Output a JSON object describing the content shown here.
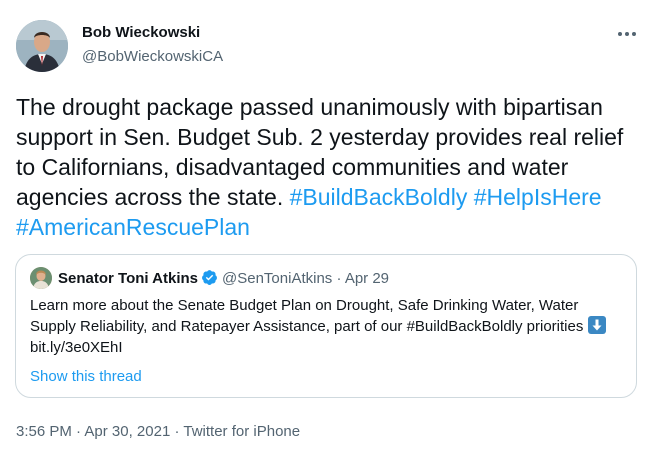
{
  "author": {
    "name": "Bob Wieckowski",
    "handle": "@BobWieckowskiCA"
  },
  "tweet": {
    "text": "The drought package passed unanimously with bipartisan support in Sen. Budget Sub. 2 yesterday provides real relief to Californians, disadvantaged communities and water agencies across the state.",
    "hashtags": [
      "#BuildBackBoldly",
      "#HelpIsHere",
      "#AmericanRescuePlan"
    ]
  },
  "quote": {
    "name": "Senator Toni Atkins",
    "handle": "@SenToniAtkins",
    "separator": "·",
    "date": "Apr 29",
    "text": "Learn more about the Senate Budget Plan on Drought, Safe Drinking Water, Water Supply Reliability, and Ratepayer Assistance, part of our #BuildBackBoldly priorities",
    "link": "bit.ly/3e0XEhI",
    "show_thread": "Show this thread"
  },
  "meta": {
    "time": "3:56 PM",
    "separator1": "·",
    "date": "Apr 30, 2021",
    "separator2": "·",
    "source": "Twitter for iPhone"
  },
  "icons": {
    "more": "more-icon",
    "verified": "verified-icon",
    "arrow": "arrow-down-icon"
  },
  "colors": {
    "accent": "#1d9bf0",
    "secondary_text": "#536471",
    "border": "#cfd9de"
  }
}
